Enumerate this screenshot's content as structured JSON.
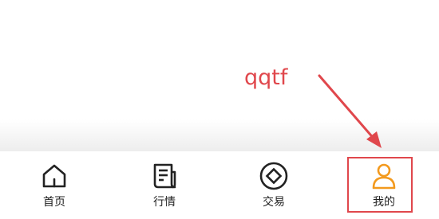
{
  "annotation": {
    "text": "qqtf",
    "color": "#e0474c"
  },
  "tabbar": {
    "tabs": [
      {
        "label": "首页",
        "icon": "home-icon",
        "active": false
      },
      {
        "label": "行情",
        "icon": "news-icon",
        "active": false
      },
      {
        "label": "交易",
        "icon": "trade-icon",
        "active": false
      },
      {
        "label": "我的",
        "icon": "user-icon",
        "active": true
      }
    ],
    "active_color": "#f39a1e",
    "inactive_color": "#222222"
  }
}
